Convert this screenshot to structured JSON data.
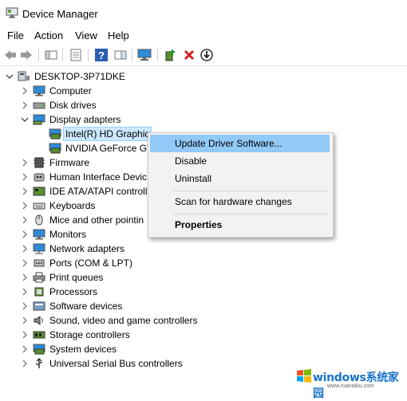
{
  "window": {
    "title": "Device Manager"
  },
  "menu": [
    "File",
    "Action",
    "View",
    "Help"
  ],
  "toolbar": {
    "icons": [
      "back-arrow-icon",
      "forward-arrow-icon",
      "show-hide-tree-icon",
      "properties-icon",
      "help-icon",
      "action-pane-icon",
      "monitor-icon",
      "update-driver-icon",
      "uninstall-x-icon",
      "scan-download-icon"
    ]
  },
  "tree": {
    "root": "DESKTOP-3P71DKE",
    "items": [
      {
        "label": "Computer",
        "icon": "computer-icon"
      },
      {
        "label": "Disk drives",
        "icon": "disk-drive-icon"
      },
      {
        "label": "Display adapters",
        "icon": "display-adapter-icon",
        "expanded": true
      },
      {
        "label": "Intel(R) HD Graphic",
        "icon": "display-card-icon",
        "child": true,
        "selected": true
      },
      {
        "label": "NVIDIA GeForce GT",
        "icon": "display-card-icon",
        "child": true
      },
      {
        "label": "Firmware",
        "icon": "firmware-icon"
      },
      {
        "label": "Human Interface Devic",
        "icon": "hid-icon"
      },
      {
        "label": "IDE ATA/ATAPI controll",
        "icon": "ide-controller-icon"
      },
      {
        "label": "Keyboards",
        "icon": "keyboard-icon"
      },
      {
        "label": "Mice and other pointin",
        "icon": "mouse-icon"
      },
      {
        "label": "Monitors",
        "icon": "monitor-icon"
      },
      {
        "label": "Network adapters",
        "icon": "network-adapter-icon"
      },
      {
        "label": "Ports (COM & LPT)",
        "icon": "port-icon"
      },
      {
        "label": "Print queues",
        "icon": "printer-icon"
      },
      {
        "label": "Processors",
        "icon": "processor-icon"
      },
      {
        "label": "Software devices",
        "icon": "software-device-icon"
      },
      {
        "label": "Sound, video and game controllers",
        "icon": "speaker-icon"
      },
      {
        "label": "Storage controllers",
        "icon": "storage-controller-icon"
      },
      {
        "label": "System devices",
        "icon": "system-device-icon"
      },
      {
        "label": "Universal Serial Bus controllers",
        "icon": "usb-icon"
      }
    ]
  },
  "context_menu": {
    "update": "Update Driver Software...",
    "disable": "Disable",
    "uninstall": "Uninstall",
    "scan": "Scan for hardware changes",
    "properties": "Properties"
  },
  "watermark": {
    "text": "windows系统家园",
    "url": "www.ruanaiku.com"
  },
  "colors": {
    "menu_highlight": "#91c9f7",
    "menu_bg": "#f2f2f2",
    "selection": "#cce8ff"
  }
}
